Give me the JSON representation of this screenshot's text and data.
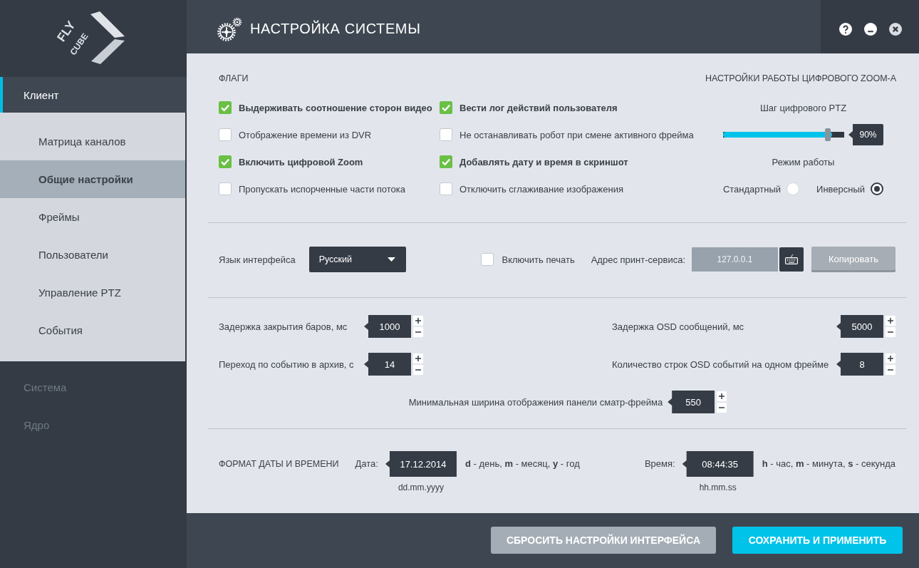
{
  "logo": {
    "lines": [
      "FLY",
      "CUBE"
    ]
  },
  "window": {
    "title": "НАСТРОЙКА СИСТЕМЫ"
  },
  "sidebar": {
    "items": [
      {
        "label": "Клиент",
        "selected": true,
        "expanded": true,
        "children": [
          {
            "label": "Матрица каналов",
            "selected": false
          },
          {
            "label": "Общие настройки",
            "selected": true
          },
          {
            "label": "Фреймы",
            "selected": false
          },
          {
            "label": "Пользователи",
            "selected": false
          },
          {
            "label": "Управление PTZ",
            "selected": false
          },
          {
            "label": "События",
            "selected": false
          }
        ]
      },
      {
        "label": "Система",
        "selected": false,
        "expanded": false
      },
      {
        "label": "Ядро",
        "selected": false,
        "expanded": false
      }
    ]
  },
  "flags": {
    "title": "ФЛАГИ",
    "items": [
      {
        "label": "Выдерживать соотношение сторон видео",
        "checked": true
      },
      {
        "label": "Вести лог действий пользователя",
        "checked": true
      },
      {
        "label": "Отображение времени из DVR",
        "checked": false
      },
      {
        "label": "Не останавливать робот при смене активного фрейма",
        "checked": false
      },
      {
        "label": "Включить цифровой Zoom",
        "checked": true
      },
      {
        "label": "Добавлять дату и время в скриншот",
        "checked": true
      },
      {
        "label": "Пропускать испорченные части потока",
        "checked": false
      },
      {
        "label": "Отключить сглаживание изображения",
        "checked": false
      }
    ]
  },
  "zoom": {
    "title": "НАСТРОЙКИ РАБОТЫ ЦИФРОВОГО ZOOM-A",
    "slider": {
      "label": "Шаг цифрового PTZ",
      "level": 0.9,
      "reading": "90%"
    },
    "mode": {
      "label": "Режим работы",
      "options": [
        {
          "label": "Стандартный",
          "selected": false
        },
        {
          "label": "Инверсный",
          "selected": true
        }
      ]
    }
  },
  "interface": {
    "language": {
      "label": "Язык интерфейса",
      "value": "Русский"
    },
    "print": {
      "label": "Включить печать",
      "checked": false
    },
    "print_service": {
      "label": "Адрес принт-сервиса:",
      "placeholder": "127.0.0.1",
      "disabled": true
    },
    "copy_button": "Копировать"
  },
  "timings": {
    "rows": [
      [
        {
          "label": "Задержка закрытия баров, мс",
          "value": "1000"
        },
        {
          "label": "Задержка OSD сообщений, мс",
          "value": "5000"
        }
      ],
      [
        {
          "label": "Переход по событию в архив, с",
          "value": "14"
        },
        {
          "label": "Количество строк OSD событий на одном фрейме",
          "value": "8"
        }
      ],
      [
        {
          "label": "Минимальная ширина отображения панели сматр-фрейма",
          "value": "550"
        }
      ]
    ]
  },
  "datetime": {
    "title": "ФОРМАТ ДАТЫ И ВРЕМЕНИ",
    "fields": [
      {
        "label": "Дата:",
        "value": "17.12.2014",
        "format": "dd.mm.yyyy",
        "legend": "**d** - день, **m** - месяц, **y** - год"
      },
      {
        "label": "Время:",
        "value": "08:44:35",
        "format": "hh.mm.ss",
        "legend": "**h** - час, **m** - минута, **s** - секунда"
      }
    ]
  },
  "buttons": [
    {
      "label": "СБРОСИТЬ НАСТРОЙКИ ИНТЕРФЕЙСА",
      "kind": "secondary"
    },
    {
      "label": "СОХРАНИТЬ И ПРИМЕНИТЬ",
      "kind": "primary"
    }
  ]
}
